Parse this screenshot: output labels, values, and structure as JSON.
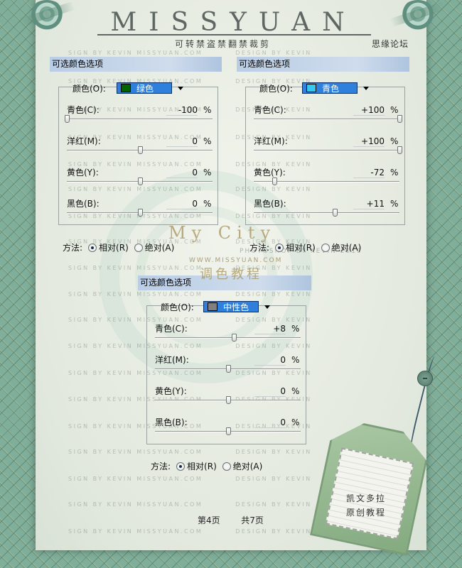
{
  "header": {
    "logo": "MISSYUAN",
    "subtitle": "可转禁盗禁翻禁裁剪",
    "forum": "思缘论坛"
  },
  "watermarks": {
    "sign": "SIGN BY KEVIN MISSYUAN.COM",
    "design": "DESIGN BY KEVIN",
    "overlay_title": "My City",
    "overlay_url": "WWW.MISSYUAN.COM",
    "overlay_subtitle": "调色教程",
    "overlay_credit": "PHOTOSHOP BY KEVIN 2010"
  },
  "panels": [
    {
      "title": "可选颜色选项",
      "color_label": "颜色(O):",
      "color_value": "绿色",
      "swatch": "#006400",
      "rows": [
        {
          "label": "青色(C):",
          "value": "-100",
          "pct": "%",
          "level": -100
        },
        {
          "label": "洋红(M):",
          "value": "0",
          "pct": "%",
          "level": 0
        },
        {
          "label": "黄色(Y):",
          "value": "0",
          "pct": "%",
          "level": 0
        },
        {
          "label": "黑色(B):",
          "value": "0",
          "pct": "%",
          "level": 0
        }
      ],
      "method_label": "方法:",
      "method_options": [
        "相对(R)",
        "绝对(A)"
      ],
      "method_selected": 0
    },
    {
      "title": "可选颜色选项",
      "color_label": "颜色(O):",
      "color_value": "青色",
      "swatch": "#35c8ee",
      "rows": [
        {
          "label": "青色(C):",
          "value": "+100",
          "pct": "%",
          "level": 100
        },
        {
          "label": "洋红(M):",
          "value": "+100",
          "pct": "%",
          "level": 100
        },
        {
          "label": "黄色(Y):",
          "value": "-72",
          "pct": "%",
          "level": -72
        },
        {
          "label": "黑色(B):",
          "value": "+11",
          "pct": "%",
          "level": 11
        }
      ],
      "method_label": "方法:",
      "method_options": [
        "相对(R)",
        "绝对(A)"
      ],
      "method_selected": 0
    },
    {
      "title": "可选颜色选项",
      "color_label": "颜色(O):",
      "color_value": "中性色",
      "swatch": "#808080",
      "rows": [
        {
          "label": "青色(C):",
          "value": "+8",
          "pct": "%",
          "level": 8
        },
        {
          "label": "洋红(M):",
          "value": "0",
          "pct": "%",
          "level": 0
        },
        {
          "label": "黄色(Y):",
          "value": "0",
          "pct": "%",
          "level": 0
        },
        {
          "label": "黑色(B):",
          "value": "0",
          "pct": "%",
          "level": 0
        }
      ],
      "method_label": "方法:",
      "method_options": [
        "相对(R)",
        "绝对(A)"
      ],
      "method_selected": 0
    }
  ],
  "tag": {
    "line1": "凯文多拉",
    "line2": "原创教程"
  },
  "pagination": {
    "current": "第4页",
    "total": "共7页"
  }
}
